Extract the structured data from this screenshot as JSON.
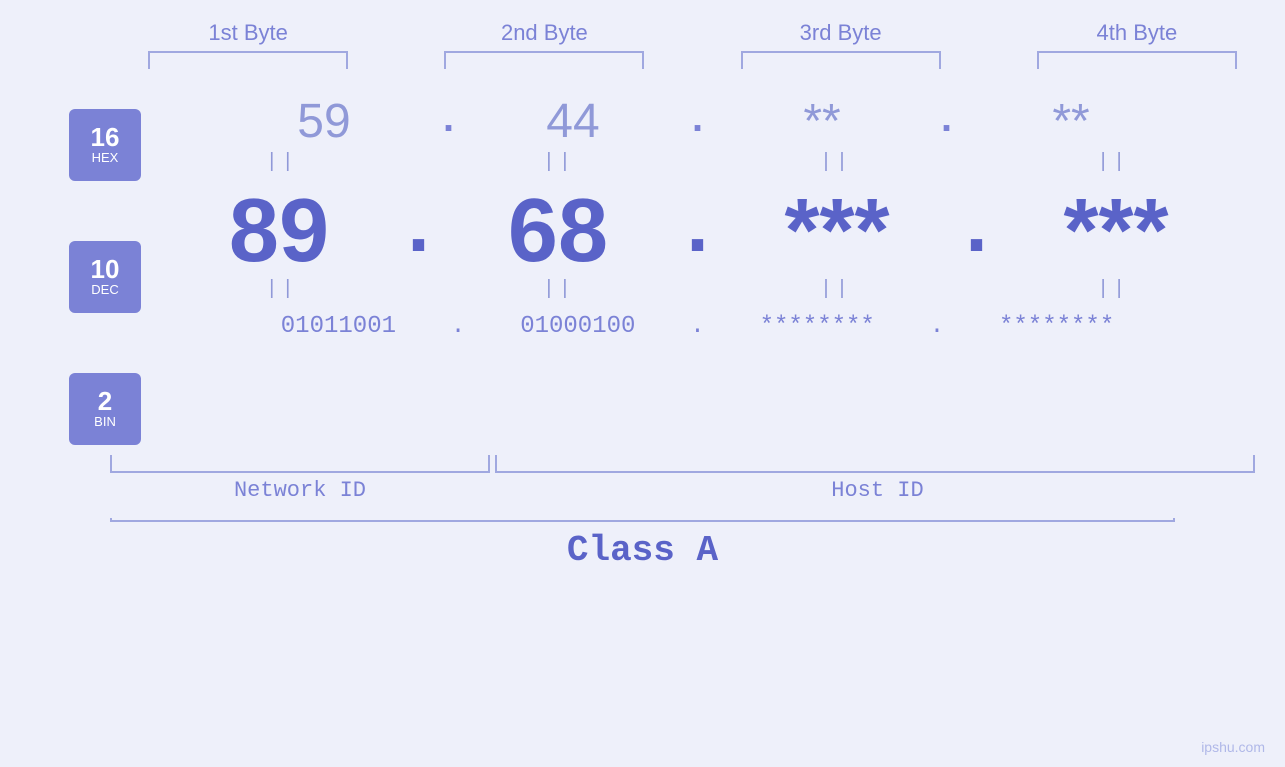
{
  "header": {
    "byte1": "1st Byte",
    "byte2": "2nd Byte",
    "byte3": "3rd Byte",
    "byte4": "4th Byte"
  },
  "badges": {
    "hex": {
      "num": "16",
      "label": "HEX"
    },
    "dec": {
      "num": "10",
      "label": "DEC"
    },
    "bin": {
      "num": "2",
      "label": "BIN"
    }
  },
  "hex_row": {
    "b1": "59",
    "b2": "44",
    "b3": "**",
    "b4": "**",
    "dot": "."
  },
  "dec_row": {
    "b1": "89",
    "b2": "68",
    "b3": "***",
    "b4": "***",
    "dot": "."
  },
  "bin_row": {
    "b1": "01011001",
    "b2": "01000100",
    "b3": "********",
    "b4": "********",
    "dot": "."
  },
  "labels": {
    "network_id": "Network ID",
    "host_id": "Host ID",
    "class": "Class A"
  },
  "watermark": "ipshu.com"
}
